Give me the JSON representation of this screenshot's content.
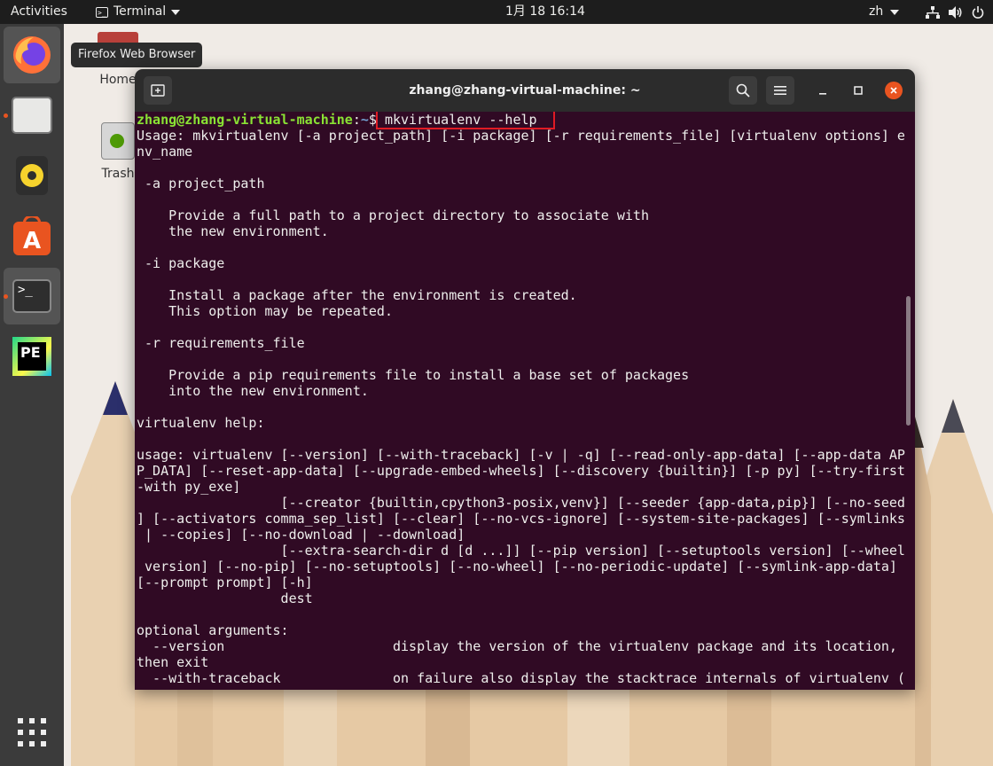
{
  "topbar": {
    "activities": "Activities",
    "app_name": "Terminal",
    "clock": "1月 18  16:14",
    "lang": "zh"
  },
  "tooltip": "Firefox Web Browser",
  "desktop": {
    "home_label": "Home",
    "trash_label": "Trash"
  },
  "dock": {
    "items": [
      "firefox-icon",
      "files-icon",
      "rhythmbox-icon",
      "software-icon",
      "terminal-icon",
      "pycharm-icon",
      "app-grid-icon"
    ],
    "pycharm_text": "PE"
  },
  "terminal": {
    "title": "zhang@zhang-virtual-machine: ~",
    "prompt_user": "zhang@zhang-virtual-machine",
    "prompt_sep": ":",
    "prompt_path": "~",
    "prompt_symbol": "$ ",
    "command": "mkvirtualenv --help",
    "output": "Usage: mkvirtualenv [-a project_path] [-i package] [-r requirements_file] [virtualenv options] e\nnv_name\n\n -a project_path\n\n    Provide a full path to a project directory to associate with\n    the new environment.\n\n -i package\n\n    Install a package after the environment is created.\n    This option may be repeated.\n\n -r requirements_file\n\n    Provide a pip requirements file to install a base set of packages\n    into the new environment.\n\nvirtualenv help:\n\nusage: virtualenv [--version] [--with-traceback] [-v | -q] [--read-only-app-data] [--app-data AP\nP_DATA] [--reset-app-data] [--upgrade-embed-wheels] [--discovery {builtin}] [-p py] [--try-first\n-with py_exe]\n                  [--creator {builtin,cpython3-posix,venv}] [--seeder {app-data,pip}] [--no-seed\n] [--activators comma_sep_list] [--clear] [--no-vcs-ignore] [--system-site-packages] [--symlinks\n | --copies] [--no-download | --download]\n                  [--extra-search-dir d [d ...]] [--pip version] [--setuptools version] [--wheel\n version] [--no-pip] [--no-setuptools] [--no-wheel] [--no-periodic-update] [--symlink-app-data]\n[--prompt prompt] [-h]\n                  dest\n\noptional arguments:\n  --version                     display the version of the virtualenv package and its location,\nthen exit\n  --with-traceback              on failure also display the stacktrace internals of virtualenv ("
  }
}
